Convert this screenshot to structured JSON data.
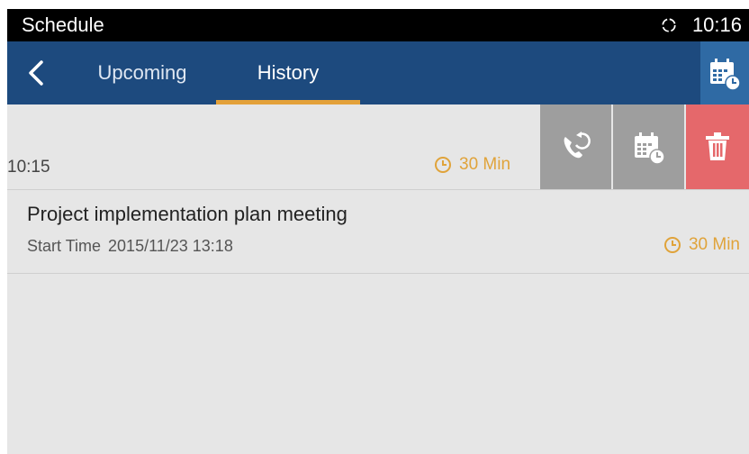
{
  "status_bar": {
    "title": "Schedule",
    "time": "10:16",
    "sync_icon": "sync-icon"
  },
  "tabs": [
    {
      "label": "Upcoming",
      "active": false
    },
    {
      "label": "History",
      "active": true
    }
  ],
  "colors": {
    "header": "#1d4a7e",
    "accent": "#e3a13a",
    "delete": "#e5686b",
    "action_gray": "#9e9e9e"
  },
  "swiped_row": {
    "time": "10:15",
    "duration": "30 Min",
    "actions": [
      "redial-call-icon",
      "schedule-calendar-icon",
      "delete-trash-icon"
    ]
  },
  "meetings": [
    {
      "title": "Project implementation plan meeting",
      "start_label": "Start Time",
      "start_value": "2015/11/23 13:18",
      "duration": "30 Min"
    }
  ]
}
